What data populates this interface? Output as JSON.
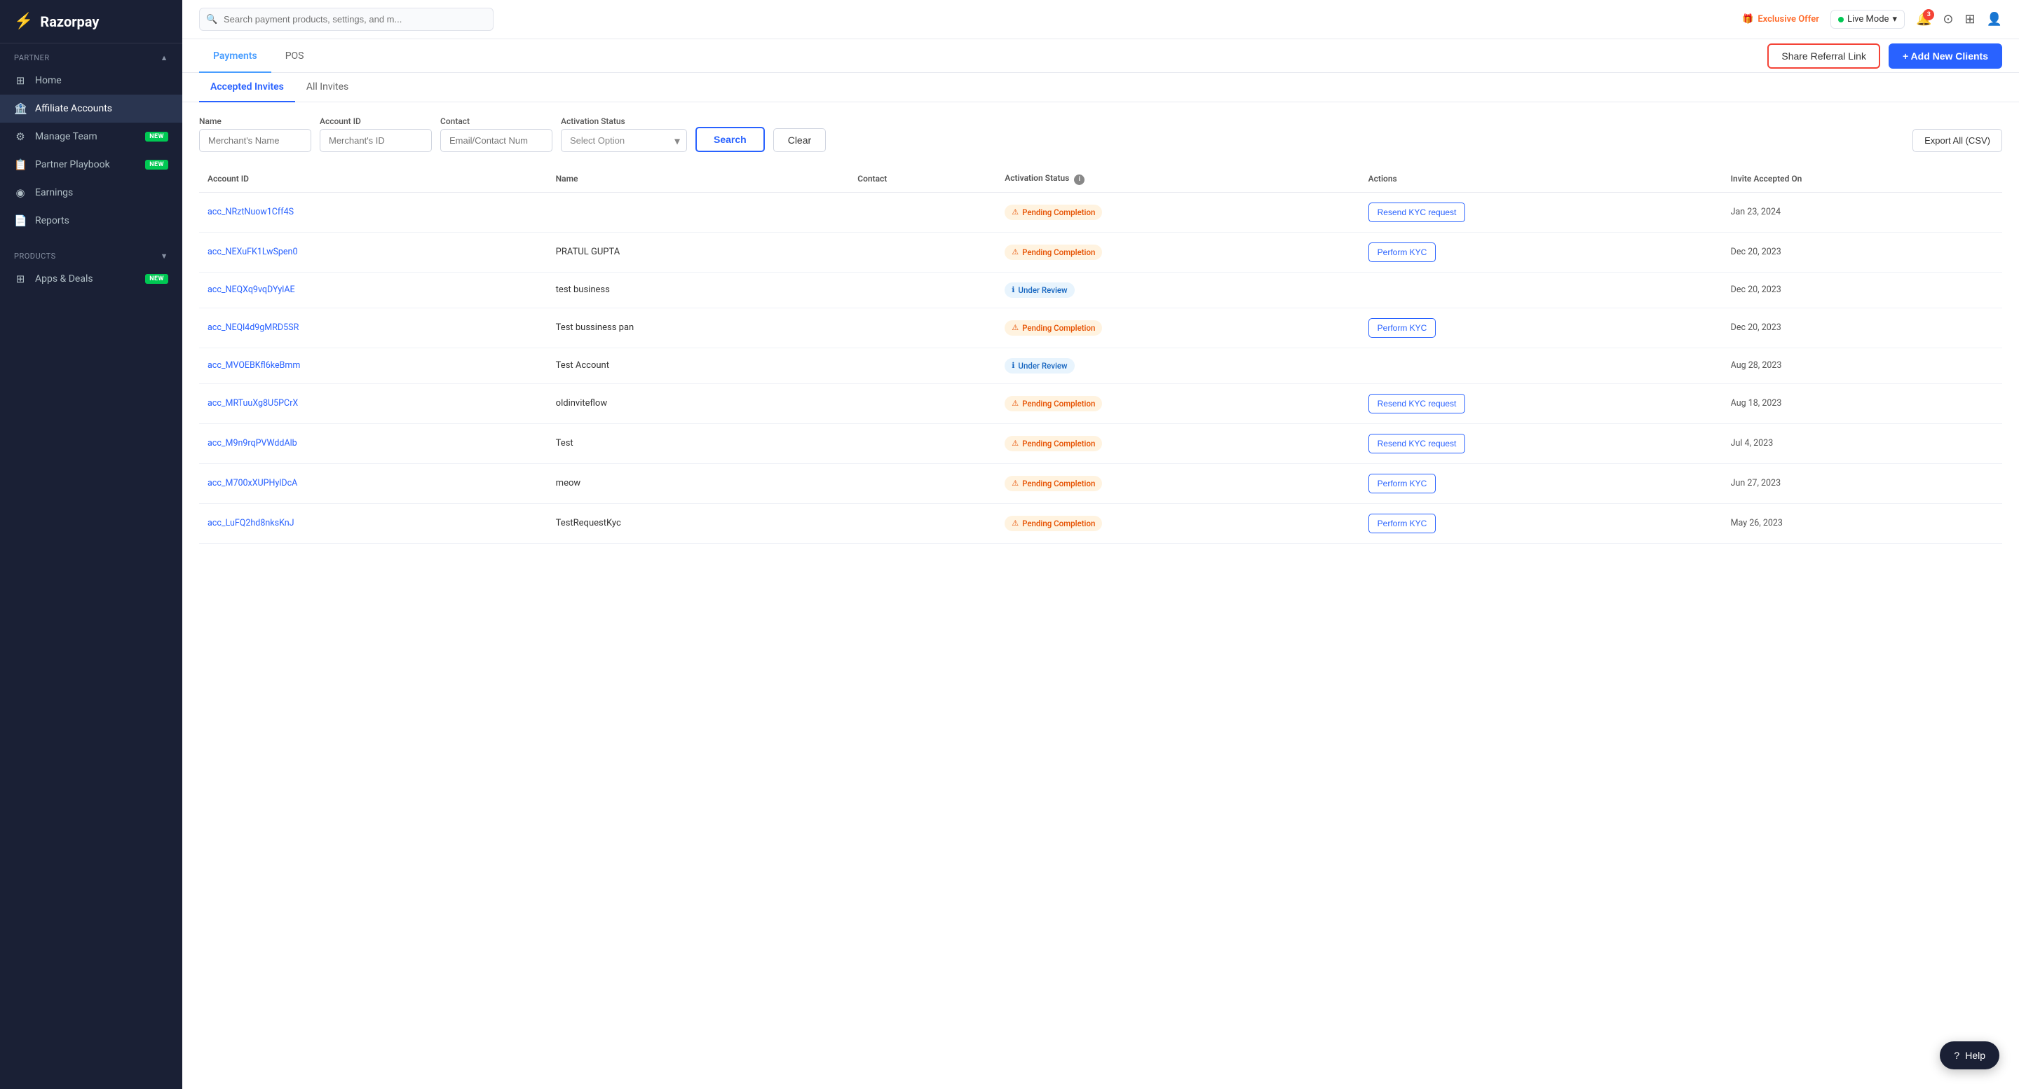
{
  "sidebar": {
    "logo": "Razorpay",
    "logo_icon": "⚡",
    "sections": [
      {
        "title": "Partner",
        "has_chevron": true,
        "items": [
          {
            "id": "home",
            "label": "Home",
            "icon": "⊞",
            "active": false,
            "badge": null
          },
          {
            "id": "affiliate-accounts",
            "label": "Affiliate Accounts",
            "icon": "🏦",
            "active": true,
            "badge": null
          },
          {
            "id": "manage-team",
            "label": "Manage Team",
            "icon": "⚙️",
            "active": false,
            "badge": "NEW"
          },
          {
            "id": "partner-playbook",
            "label": "Partner Playbook",
            "icon": "📋",
            "active": false,
            "badge": "NEW"
          },
          {
            "id": "earnings",
            "label": "Earnings",
            "icon": "◉",
            "active": false,
            "badge": null
          },
          {
            "id": "reports",
            "label": "Reports",
            "icon": "📄",
            "active": false,
            "badge": null
          }
        ]
      },
      {
        "title": "Products",
        "has_chevron": true,
        "items": [
          {
            "id": "apps-deals",
            "label": "Apps & Deals",
            "icon": "⊞",
            "active": false,
            "badge": "NEW"
          }
        ]
      }
    ]
  },
  "header": {
    "search_placeholder": "Search payment products, settings, and m...",
    "exclusive_offer_label": "Exclusive Offer",
    "live_mode_label": "Live Mode",
    "notification_count": "3"
  },
  "tabs": {
    "main": [
      {
        "id": "payments",
        "label": "Payments",
        "active": true
      },
      {
        "id": "pos",
        "label": "POS",
        "active": false
      }
    ],
    "share_referral_label": "Share Referral Link",
    "add_clients_label": "+ Add New Clients"
  },
  "subtabs": [
    {
      "id": "accepted-invites",
      "label": "Accepted Invites",
      "active": true
    },
    {
      "id": "all-invites",
      "label": "All Invites",
      "active": false
    }
  ],
  "filters": {
    "name_label": "Name",
    "name_placeholder": "Merchant's Name",
    "account_id_label": "Account ID",
    "account_id_placeholder": "Merchant's ID",
    "contact_label": "Contact",
    "contact_placeholder": "Email/Contact Num",
    "activation_status_label": "Activation Status",
    "activation_status_placeholder": "Select Option",
    "search_label": "Search",
    "clear_label": "Clear",
    "export_label": "Export All (CSV)"
  },
  "table": {
    "columns": [
      {
        "id": "account-id",
        "label": "Account ID"
      },
      {
        "id": "name",
        "label": "Name"
      },
      {
        "id": "contact",
        "label": "Contact"
      },
      {
        "id": "activation-status",
        "label": "Activation Status",
        "has_info": true
      },
      {
        "id": "actions",
        "label": "Actions"
      },
      {
        "id": "invite-accepted-on",
        "label": "Invite Accepted On"
      }
    ],
    "rows": [
      {
        "account_id": "acc_NRztNuow1Cff4S",
        "name": "",
        "contact": "",
        "status": "Pending Completion",
        "status_type": "pending",
        "action": "Resend KYC request",
        "date": "Jan 23, 2024"
      },
      {
        "account_id": "acc_NEXuFK1LwSpen0",
        "name": "PRATUL GUPTA",
        "contact": "",
        "status": "Pending Completion",
        "status_type": "pending",
        "action": "Perform KYC",
        "date": "Dec 20, 2023"
      },
      {
        "account_id": "acc_NEQXq9vqDYylAE",
        "name": "test business",
        "contact": "",
        "status": "Under Review",
        "status_type": "review",
        "action": "",
        "date": "Dec 20, 2023"
      },
      {
        "account_id": "acc_NEQl4d9gMRD5SR",
        "name": "Test bussiness pan",
        "contact": "",
        "status": "Pending Completion",
        "status_type": "pending",
        "action": "Perform KYC",
        "date": "Dec 20, 2023"
      },
      {
        "account_id": "acc_MVOEBKfl6keBmm",
        "name": "Test Account",
        "contact": "",
        "status": "Under Review",
        "status_type": "review",
        "action": "",
        "date": "Aug 28, 2023"
      },
      {
        "account_id": "acc_MRTuuXg8U5PCrX",
        "name": "oldinviteflow",
        "contact": "",
        "status": "Pending Completion",
        "status_type": "pending",
        "action": "Resend KYC request",
        "date": "Aug 18, 2023"
      },
      {
        "account_id": "acc_M9n9rqPVWddAlb",
        "name": "Test",
        "contact": "",
        "status": "Pending Completion",
        "status_type": "pending",
        "action": "Resend KYC request",
        "date": "Jul 4, 2023"
      },
      {
        "account_id": "acc_M700xXUPHylDcA",
        "name": "meow",
        "contact": "",
        "status": "Pending Completion",
        "status_type": "pending",
        "action": "Perform KYC",
        "date": "Jun 27, 2023"
      },
      {
        "account_id": "acc_LuFQ2hd8nksKnJ",
        "name": "TestRequestKyc",
        "contact": "",
        "status": "Pending Completion",
        "status_type": "pending",
        "action": "Perform KYC",
        "date": "May 26, 2023"
      }
    ]
  },
  "help": {
    "label": "Help"
  }
}
